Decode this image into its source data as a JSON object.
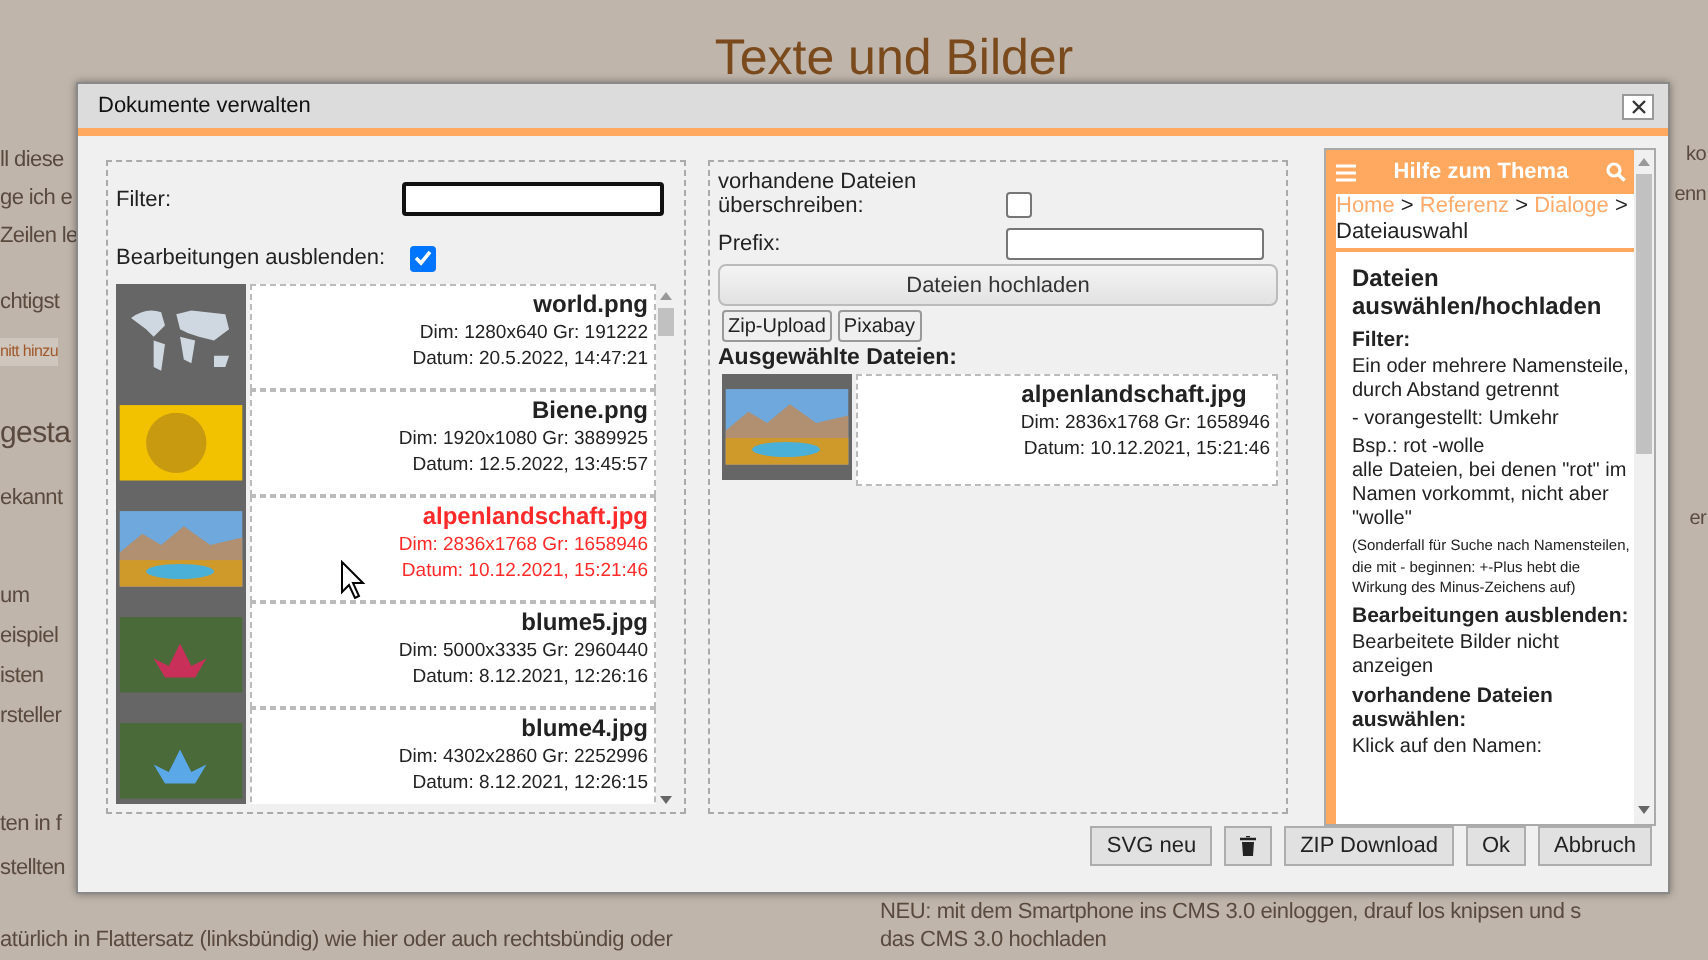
{
  "page": {
    "title": "Texte und Bilder",
    "left_fragments": [
      {
        "text": "ll diese",
        "kind": "text"
      },
      {
        "text": "ge ich e",
        "kind": "text"
      },
      {
        "text": "Zeilen le",
        "kind": "text"
      },
      {
        "text": "chtigst",
        "kind": "text"
      },
      {
        "text": "nitt hinzu",
        "kind": "link"
      },
      {
        "text": "gesta",
        "kind": "heading"
      },
      {
        "text": "ekannt",
        "kind": "text"
      },
      {
        "text": "um",
        "kind": "text"
      },
      {
        "text": "eispiel",
        "kind": "text"
      },
      {
        "text": "isten",
        "kind": "text"
      },
      {
        "text": "rsteller",
        "kind": "text"
      },
      {
        "text": "ten in f",
        "kind": "text"
      },
      {
        "text": "stellten",
        "kind": "text"
      }
    ],
    "right_fragments": [
      "ko",
      "enn",
      "er"
    ],
    "bottom_left": "atürlich in Flattersatz (linksbündig) wie hier oder auch rechtsbündig oder",
    "bottom_right": [
      "NEU: mit dem Smartphone ins CMS 3.0 einloggen, drauf los knipsen und s",
      "das CMS 3.0 hochladen"
    ]
  },
  "dialog": {
    "title": "Dokumente verwalten",
    "left": {
      "filter_label": "Filter:",
      "hide_edits_label": "Bearbeitungen ausblenden:",
      "hide_edits_checked": true,
      "files": [
        {
          "name": "world.png",
          "dim": "Dim: 1280x640 Gr: 191222",
          "date": "Datum: 20.5.2022, 14:47:21",
          "selected": false
        },
        {
          "name": "Biene.png",
          "dim": "Dim: 1920x1080 Gr: 3889925",
          "date": "Datum: 12.5.2022, 13:45:57",
          "selected": false
        },
        {
          "name": "alpenlandschaft.jpg",
          "dim": "Dim: 2836x1768 Gr: 1658946",
          "date": "Datum: 10.12.2021, 15:21:46",
          "selected": true
        },
        {
          "name": "blume5.jpg",
          "dim": "Dim: 5000x3335 Gr: 2960440",
          "date": "Datum: 8.12.2021, 12:26:16",
          "selected": false
        },
        {
          "name": "blume4.jpg",
          "dim": "Dim: 4302x2860 Gr: 2252996",
          "date": "Datum: 8.12.2021, 12:26:15",
          "selected": false
        }
      ]
    },
    "middle": {
      "overwrite_label": "vorhandene Dateien überschreiben:",
      "overwrite_checked": false,
      "prefix_label": "Prefix:",
      "upload_button": "Dateien hochladen",
      "small_buttons": [
        "Zip-Upload",
        "Pixabay"
      ],
      "selected_heading": "Ausgewählte Dateien:",
      "selected_files": [
        {
          "name": "alpenlandschaft.jpg",
          "dim": "Dim: 2836x1768 Gr: 1658946",
          "date": "Datum: 10.12.2021, 15:21:46"
        }
      ]
    },
    "help": {
      "title": "Hilfe zum Thema",
      "breadcrumb": {
        "links": [
          "Home",
          "Referenz",
          "Dialoge"
        ],
        "separator": ">",
        "current": "Dateiauswahl"
      },
      "content": [
        {
          "kind": "heading",
          "text": "Dateien auswählen/hochladen"
        },
        {
          "kind": "label",
          "text": "Filter:"
        },
        {
          "kind": "text",
          "text": "Ein oder mehrere Namensteile, durch Abstand getrennt"
        },
        {
          "kind": "text",
          "text": "- vorangestellt: Umkehr"
        },
        {
          "kind": "text",
          "text": "Bsp.: rot -wolle\nalle Dateien, bei denen \"rot\" im Namen vorkommt, nicht aber \"wolle\""
        },
        {
          "kind": "small",
          "text": "(Sonderfall für Suche nach Namensteilen, die mit - beginnen: +-Plus hebt die Wirkung des Minus-Zeichens auf)"
        },
        {
          "kind": "label",
          "text": "Bearbeitungen ausblenden:"
        },
        {
          "kind": "text",
          "text": "Bearbeitete Bilder nicht anzeigen"
        },
        {
          "kind": "label",
          "text": "vorhandene Dateien auswählen:"
        },
        {
          "kind": "text",
          "text": "Klick auf den Namen:"
        }
      ]
    },
    "footer": [
      {
        "kind": "text",
        "label": "SVG neu"
      },
      {
        "kind": "trash"
      },
      {
        "kind": "text",
        "label": "ZIP Download"
      },
      {
        "kind": "text",
        "label": "Ok"
      },
      {
        "kind": "text",
        "label": "Abbruch"
      }
    ]
  }
}
